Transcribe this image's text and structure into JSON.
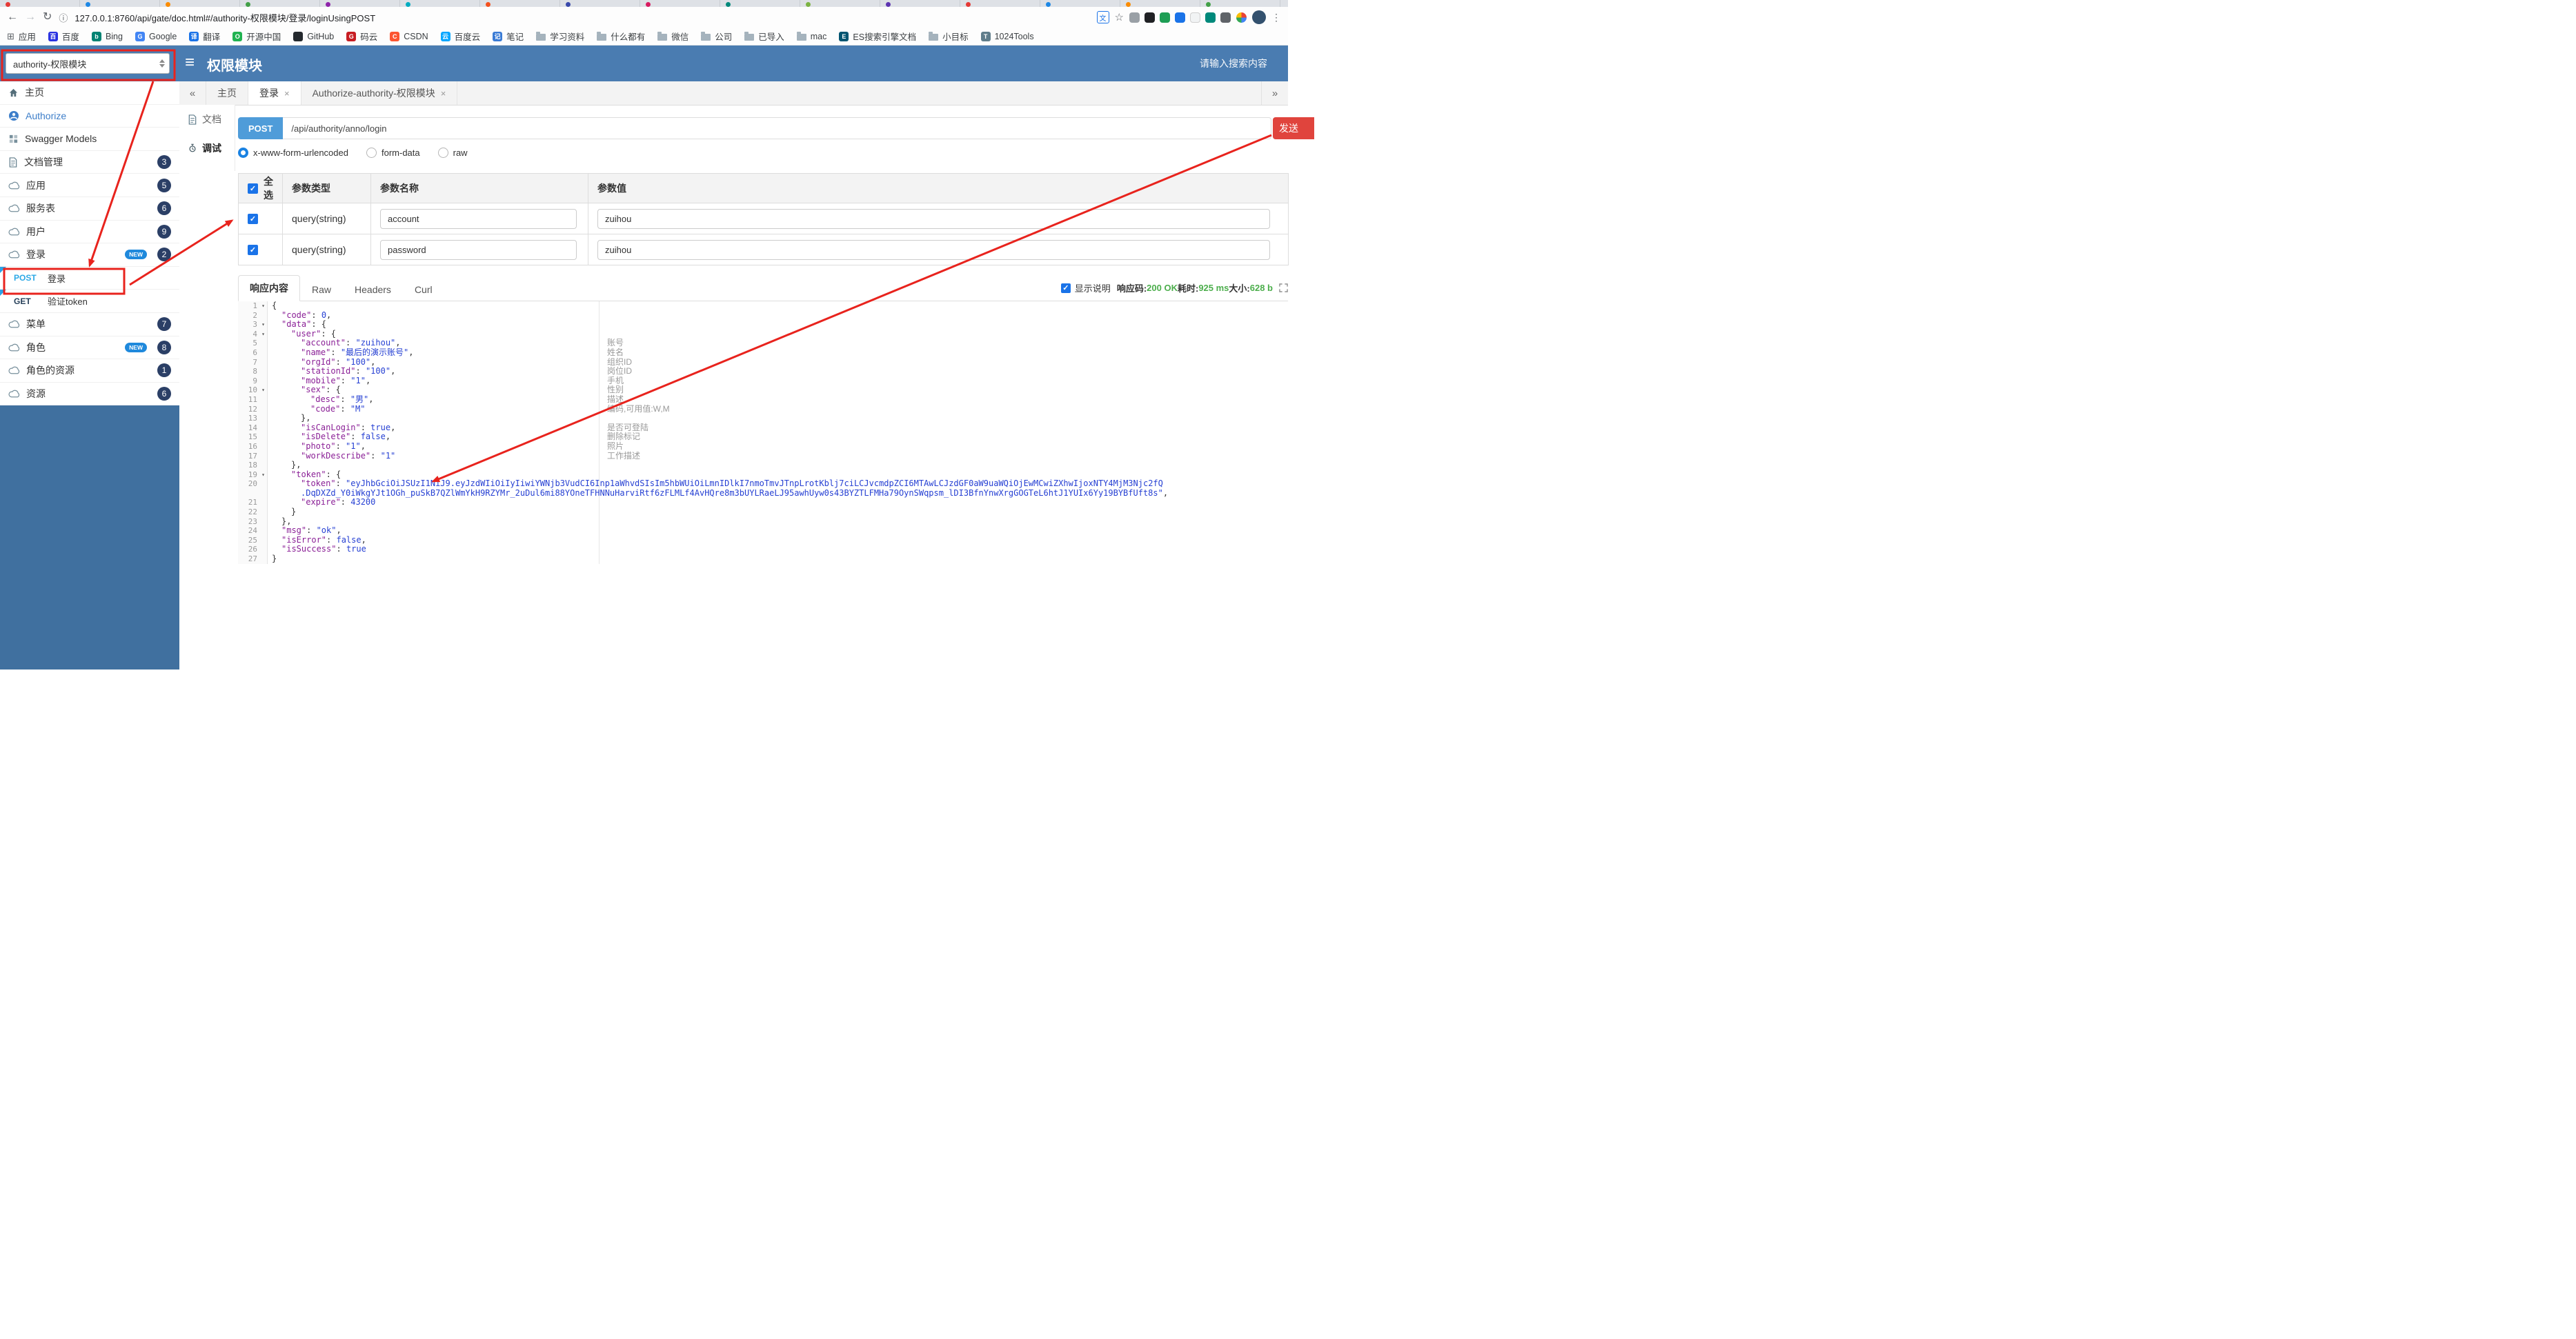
{
  "browser": {
    "url": "127.0.0.1:8760/api/gate/doc.html#/authority-权限模块/登录/loginUsingPOST",
    "tab_favicons": [
      "#e53935",
      "#1e88e5",
      "#fb8c00",
      "#43a047",
      "#8e24aa",
      "#00acc1",
      "#f4511e",
      "#3949ab",
      "#d81b60",
      "#00897b",
      "#7cb342",
      "#5e35b1",
      "#e53935",
      "#1e88e5",
      "#fb8c00",
      "#43a047"
    ],
    "extension_colors": [
      "#9aa0a6",
      "#202124",
      "#1e9e55",
      "#1a73e8",
      "#f1f3f4",
      "#00897b",
      "#5f6368"
    ],
    "bookmarks": [
      {
        "label": "应用",
        "apps": true
      },
      {
        "label": "百度",
        "glyph": "百",
        "color": "#2932e1"
      },
      {
        "label": "Bing",
        "glyph": "b",
        "color": "#008373"
      },
      {
        "label": "Google",
        "glyph": "G",
        "color": "#4285f4"
      },
      {
        "label": "翻译",
        "glyph": "译",
        "color": "#1a73e8"
      },
      {
        "label": "开源中国",
        "glyph": "O",
        "color": "#21b351"
      },
      {
        "label": "GitHub",
        "glyph": "",
        "color": "#24292e"
      },
      {
        "label": "码云",
        "glyph": "G",
        "color": "#c71d23"
      },
      {
        "label": "CSDN",
        "glyph": "C",
        "color": "#fc5531"
      },
      {
        "label": "百度云",
        "glyph": "云",
        "color": "#06a7ff"
      },
      {
        "label": "笔记",
        "glyph": "记",
        "color": "#3a7bd5"
      },
      {
        "label": "学习资料",
        "folder": true
      },
      {
        "label": "什么都有",
        "folder": true
      },
      {
        "label": "微信",
        "folder": true
      },
      {
        "label": "公司",
        "folder": true
      },
      {
        "label": "已导入",
        "folder": true
      },
      {
        "label": "mac",
        "folder": true
      },
      {
        "label": "ES搜索引擎文档",
        "glyph": "E",
        "color": "#005571"
      },
      {
        "label": "小目标",
        "folder": true
      },
      {
        "label": "1024Tools",
        "glyph": "T",
        "color": "#607d8b"
      }
    ]
  },
  "header": {
    "module_select_value": "authority-权限模块",
    "title": "权限模块",
    "search_placeholder": "请输入搜索内容"
  },
  "sidebar": {
    "new_tag": "NEW",
    "items": [
      {
        "key": "home",
        "label": "主页",
        "icon": "home-icon"
      },
      {
        "key": "authorize",
        "label": "Authorize",
        "icon": "authorize-icon",
        "link": true
      },
      {
        "key": "swagger-models",
        "label": "Swagger Models",
        "icon": "models-icon"
      },
      {
        "key": "doc-manage",
        "label": "文档管理",
        "icon": "docfile-icon",
        "badge": "3"
      },
      {
        "key": "app",
        "label": "应用",
        "icon": "cloud-icon",
        "badge": "5"
      },
      {
        "key": "service-table",
        "label": "服务表",
        "icon": "cloud-icon",
        "badge": "6"
      },
      {
        "key": "user",
        "label": "用户",
        "icon": "cloud-icon",
        "badge": "9"
      },
      {
        "key": "login",
        "label": "登录",
        "icon": "cloud-icon",
        "badge": "2",
        "new": true
      },
      {
        "key": "login-post",
        "label": "登录",
        "method": "POST",
        "child": true,
        "corner": true
      },
      {
        "key": "verify-token-get",
        "label": "验证token",
        "method": "GET",
        "child": true,
        "corner": true
      },
      {
        "key": "menu",
        "label": "菜单",
        "icon": "cloud-icon",
        "badge": "7"
      },
      {
        "key": "role",
        "label": "角色",
        "icon": "cloud-icon",
        "badge": "8",
        "new": true
      },
      {
        "key": "role-resource",
        "label": "角色的资源",
        "icon": "cloud-icon",
        "badge": "1"
      },
      {
        "key": "resource",
        "label": "资源",
        "icon": "cloud-icon",
        "badge": "6"
      }
    ]
  },
  "doc_tabs": {
    "tabs": [
      {
        "label": "主页",
        "closable": false
      },
      {
        "label": "登录",
        "closable": true,
        "active": true
      },
      {
        "label": "Authorize-authority-权限模块",
        "closable": true
      }
    ]
  },
  "view_tabs": {
    "doc": "文档",
    "debug": "调试"
  },
  "request": {
    "method": "POST",
    "url": "/api/authority/anno/login",
    "send_label": "发送",
    "content_types": [
      {
        "label": "x-www-form-urlencoded",
        "selected": true
      },
      {
        "label": "form-data",
        "selected": false
      },
      {
        "label": "raw",
        "selected": false
      }
    ],
    "table": {
      "headers": {
        "select_all": "全选",
        "type": "参数类型",
        "name": "参数名称",
        "value": "参数值"
      },
      "rows": [
        {
          "checked": true,
          "type": "query(string)",
          "name": "account",
          "value": "zuihou"
        },
        {
          "checked": true,
          "type": "query(string)",
          "name": "password",
          "value": "zuihou"
        }
      ]
    }
  },
  "response": {
    "tabs": [
      {
        "label": "响应内容",
        "active": true
      },
      {
        "label": "Raw",
        "active": false
      },
      {
        "label": "Headers",
        "active": false
      },
      {
        "label": "Curl",
        "active": false
      }
    ],
    "show_desc_label": "显示说明",
    "status": {
      "code_label": "响应码:",
      "code": "200 OK",
      "time_label": "耗时:",
      "time": "925 ms",
      "size_label": "大小:",
      "size": "628 b"
    }
  },
  "response_json": {
    "lines": [
      {
        "n": "1",
        "fold": true,
        "i": 0,
        "t": [
          [
            "p",
            "{"
          ]
        ]
      },
      {
        "n": "2",
        "i": 1,
        "t": [
          [
            "k",
            "\"code\""
          ],
          [
            "p",
            ": "
          ],
          [
            "n",
            "0"
          ],
          [
            "p",
            ","
          ]
        ]
      },
      {
        "n": "3",
        "fold": true,
        "i": 1,
        "t": [
          [
            "k",
            "\"data\""
          ],
          [
            "p",
            ": {"
          ]
        ]
      },
      {
        "n": "4",
        "fold": true,
        "i": 2,
        "t": [
          [
            "k",
            "\"user\""
          ],
          [
            "p",
            ": {"
          ]
        ]
      },
      {
        "n": "5",
        "i": 3,
        "t": [
          [
            "k",
            "\"account\""
          ],
          [
            "p",
            ": "
          ],
          [
            "s",
            "\"zuihou\""
          ],
          [
            "p",
            ","
          ]
        ],
        "note": "账号"
      },
      {
        "n": "6",
        "i": 3,
        "t": [
          [
            "k",
            "\"name\""
          ],
          [
            "p",
            ": "
          ],
          [
            "s",
            "\"最后的演示账号\""
          ],
          [
            "p",
            ","
          ]
        ],
        "note": "姓名"
      },
      {
        "n": "7",
        "i": 3,
        "t": [
          [
            "k",
            "\"orgId\""
          ],
          [
            "p",
            ": "
          ],
          [
            "s",
            "\"100\""
          ],
          [
            "p",
            ","
          ]
        ],
        "note": "组织ID"
      },
      {
        "n": "8",
        "i": 3,
        "t": [
          [
            "k",
            "\"stationId\""
          ],
          [
            "p",
            ": "
          ],
          [
            "s",
            "\"100\""
          ],
          [
            "p",
            ","
          ]
        ],
        "note": "岗位ID"
      },
      {
        "n": "9",
        "i": 3,
        "t": [
          [
            "k",
            "\"mobile\""
          ],
          [
            "p",
            ": "
          ],
          [
            "s",
            "\"1\""
          ],
          [
            "p",
            ","
          ]
        ],
        "note": "手机"
      },
      {
        "n": "10",
        "fold": true,
        "i": 3,
        "t": [
          [
            "k",
            "\"sex\""
          ],
          [
            "p",
            ": {"
          ]
        ],
        "note": "性别"
      },
      {
        "n": "11",
        "i": 4,
        "t": [
          [
            "k",
            "\"desc\""
          ],
          [
            "p",
            ": "
          ],
          [
            "s",
            "\"男\""
          ],
          [
            "p",
            ","
          ]
        ],
        "note": "描述"
      },
      {
        "n": "12",
        "i": 4,
        "t": [
          [
            "k",
            "\"code\""
          ],
          [
            "p",
            ": "
          ],
          [
            "s",
            "\"M\""
          ]
        ],
        "note": "编码,可用值:W,M"
      },
      {
        "n": "13",
        "i": 3,
        "t": [
          [
            "p",
            "},"
          ]
        ]
      },
      {
        "n": "14",
        "i": 3,
        "t": [
          [
            "k",
            "\"isCanLogin\""
          ],
          [
            "p",
            ": "
          ],
          [
            "b",
            "true"
          ],
          [
            "p",
            ","
          ]
        ],
        "note": "是否可登陆"
      },
      {
        "n": "15",
        "i": 3,
        "t": [
          [
            "k",
            "\"isDelete\""
          ],
          [
            "p",
            ": "
          ],
          [
            "b",
            "false"
          ],
          [
            "p",
            ","
          ]
        ],
        "note": "删除标记"
      },
      {
        "n": "16",
        "i": 3,
        "t": [
          [
            "k",
            "\"photo\""
          ],
          [
            "p",
            ": "
          ],
          [
            "s",
            "\"1\""
          ],
          [
            "p",
            ","
          ]
        ],
        "note": "照片"
      },
      {
        "n": "17",
        "i": 3,
        "t": [
          [
            "k",
            "\"workDescribe\""
          ],
          [
            "p",
            ": "
          ],
          [
            "s",
            "\"1\""
          ]
        ],
        "note": "工作描述"
      },
      {
        "n": "18",
        "i": 2,
        "t": [
          [
            "p",
            "},"
          ]
        ]
      },
      {
        "n": "19",
        "fold": true,
        "i": 2,
        "t": [
          [
            "k",
            "\"token\""
          ],
          [
            "p",
            ": {"
          ]
        ]
      },
      {
        "n": "20",
        "i": 3,
        "t": [
          [
            "k",
            "\"token\""
          ],
          [
            "p",
            ": "
          ],
          [
            "s",
            "\"eyJhbGciOiJSUzI1NiJ9.eyJzdWIiOiIyIiwiYWNjb3VudCI6Inp1aWhvdSIsIm5hbWUiOiLmnIDlkI7nmoTmvJTnpLrotKblj7ciLCJvcmdpZCI6MTAwLCJzdGF0aW9uaWQiOjEwMCwiZXhwIjoxNTY4MjM3Njc2fQ"
          ]
        ]
      },
      {
        "n": "",
        "i": 3,
        "t": [
          [
            "s",
            ".DqDXZd_Y0iWkgYJt1OGh_puSkB7QZlWmYkH9RZYMr_2uDul6mi88YOneTFHNNuHarviRtf6zFLMLf4AvHQre8m3bUYLRaeLJ95awhUyw0s43BYZTLFMHa79OynSWqpsm_lDI3BfnYnwXrgGOGTeL6htJ1YUIx6Yy19BYBfUft8s\""
          ],
          [
            "p",
            ","
          ]
        ]
      },
      {
        "n": "21",
        "i": 3,
        "t": [
          [
            "k",
            "\"expire\""
          ],
          [
            "p",
            ": "
          ],
          [
            "n",
            "43200"
          ]
        ]
      },
      {
        "n": "22",
        "i": 2,
        "t": [
          [
            "p",
            "}"
          ]
        ]
      },
      {
        "n": "23",
        "i": 1,
        "t": [
          [
            "p",
            "},"
          ]
        ]
      },
      {
        "n": "24",
        "i": 1,
        "t": [
          [
            "k",
            "\"msg\""
          ],
          [
            "p",
            ": "
          ],
          [
            "s",
            "\"ok\""
          ],
          [
            "p",
            ","
          ]
        ]
      },
      {
        "n": "25",
        "i": 1,
        "t": [
          [
            "k",
            "\"isError\""
          ],
          [
            "p",
            ": "
          ],
          [
            "b",
            "false"
          ],
          [
            "p",
            ","
          ]
        ]
      },
      {
        "n": "26",
        "i": 1,
        "t": [
          [
            "k",
            "\"isSuccess\""
          ],
          [
            "p",
            ": "
          ],
          [
            "b",
            "true"
          ]
        ]
      },
      {
        "n": "27",
        "i": 0,
        "t": [
          [
            "p",
            "}"
          ]
        ]
      }
    ]
  }
}
